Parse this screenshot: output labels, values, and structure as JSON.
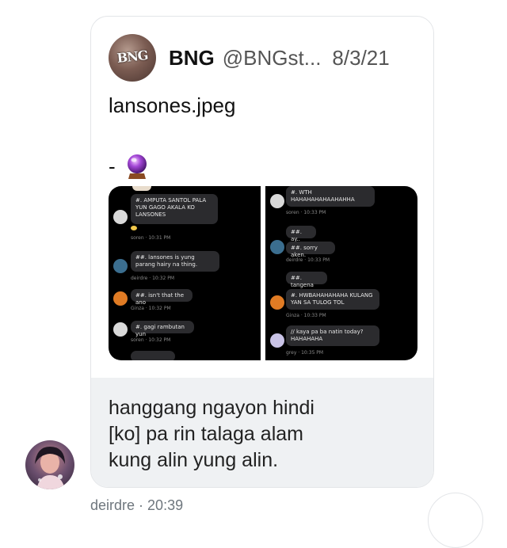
{
  "tweet": {
    "display_name": "BNG",
    "handle": "@BNGst...",
    "date": "8/3/21",
    "avatar_logo_text": "BNG",
    "text": "lansones.jpeg",
    "dash": "-",
    "emoji_icon": "crystal-ball-icon"
  },
  "screenshot_left": {
    "messages": [
      {
        "text": "#. AMPUTA SANTOL PALA YUN GAGO AKALA KO LANSONES",
        "meta": "soren · 10:31 PM"
      },
      {
        "text": "##. lansones is yung parang hairy na thing.",
        "meta": "deirdre · 10:32 PM"
      },
      {
        "text": "##. isn't that the ano",
        "meta": "Ginza · 10:32 PM"
      },
      {
        "text": "#. gagi rambutan yun",
        "meta": "soren · 10:32 PM"
      }
    ]
  },
  "screenshot_right": {
    "messages": [
      {
        "text": "#. WTH HAHAHAHAHAAHAHHA",
        "meta": "soren · 10:33 PM"
      },
      {
        "text": "##. ay..",
        "meta": ""
      },
      {
        "text": "##. sorry aken.",
        "meta": "deirdre · 10:33 PM"
      },
      {
        "text": "##. tangena",
        "meta": ""
      },
      {
        "text": "#. HWBAHAHAHAHA KULANG YAN SA TULOG TOL",
        "meta": "Ginza · 10:33 PM"
      },
      {
        "text": "// kaya pa ba natin today? HAHAHAHA",
        "meta": "grey · 10:35 PM"
      }
    ]
  },
  "reply": {
    "line1": "hanggang ngayon hindi",
    "line2": "[ko] pa rin talaga alam",
    "line3": "kung alin yung alin."
  },
  "sender": {
    "name": "deirdre",
    "time": "· 20:39"
  },
  "colors": {
    "card_border": "#e3e5e8",
    "reply_bg": "#eff1f3",
    "meta_text": "#6e767d"
  }
}
